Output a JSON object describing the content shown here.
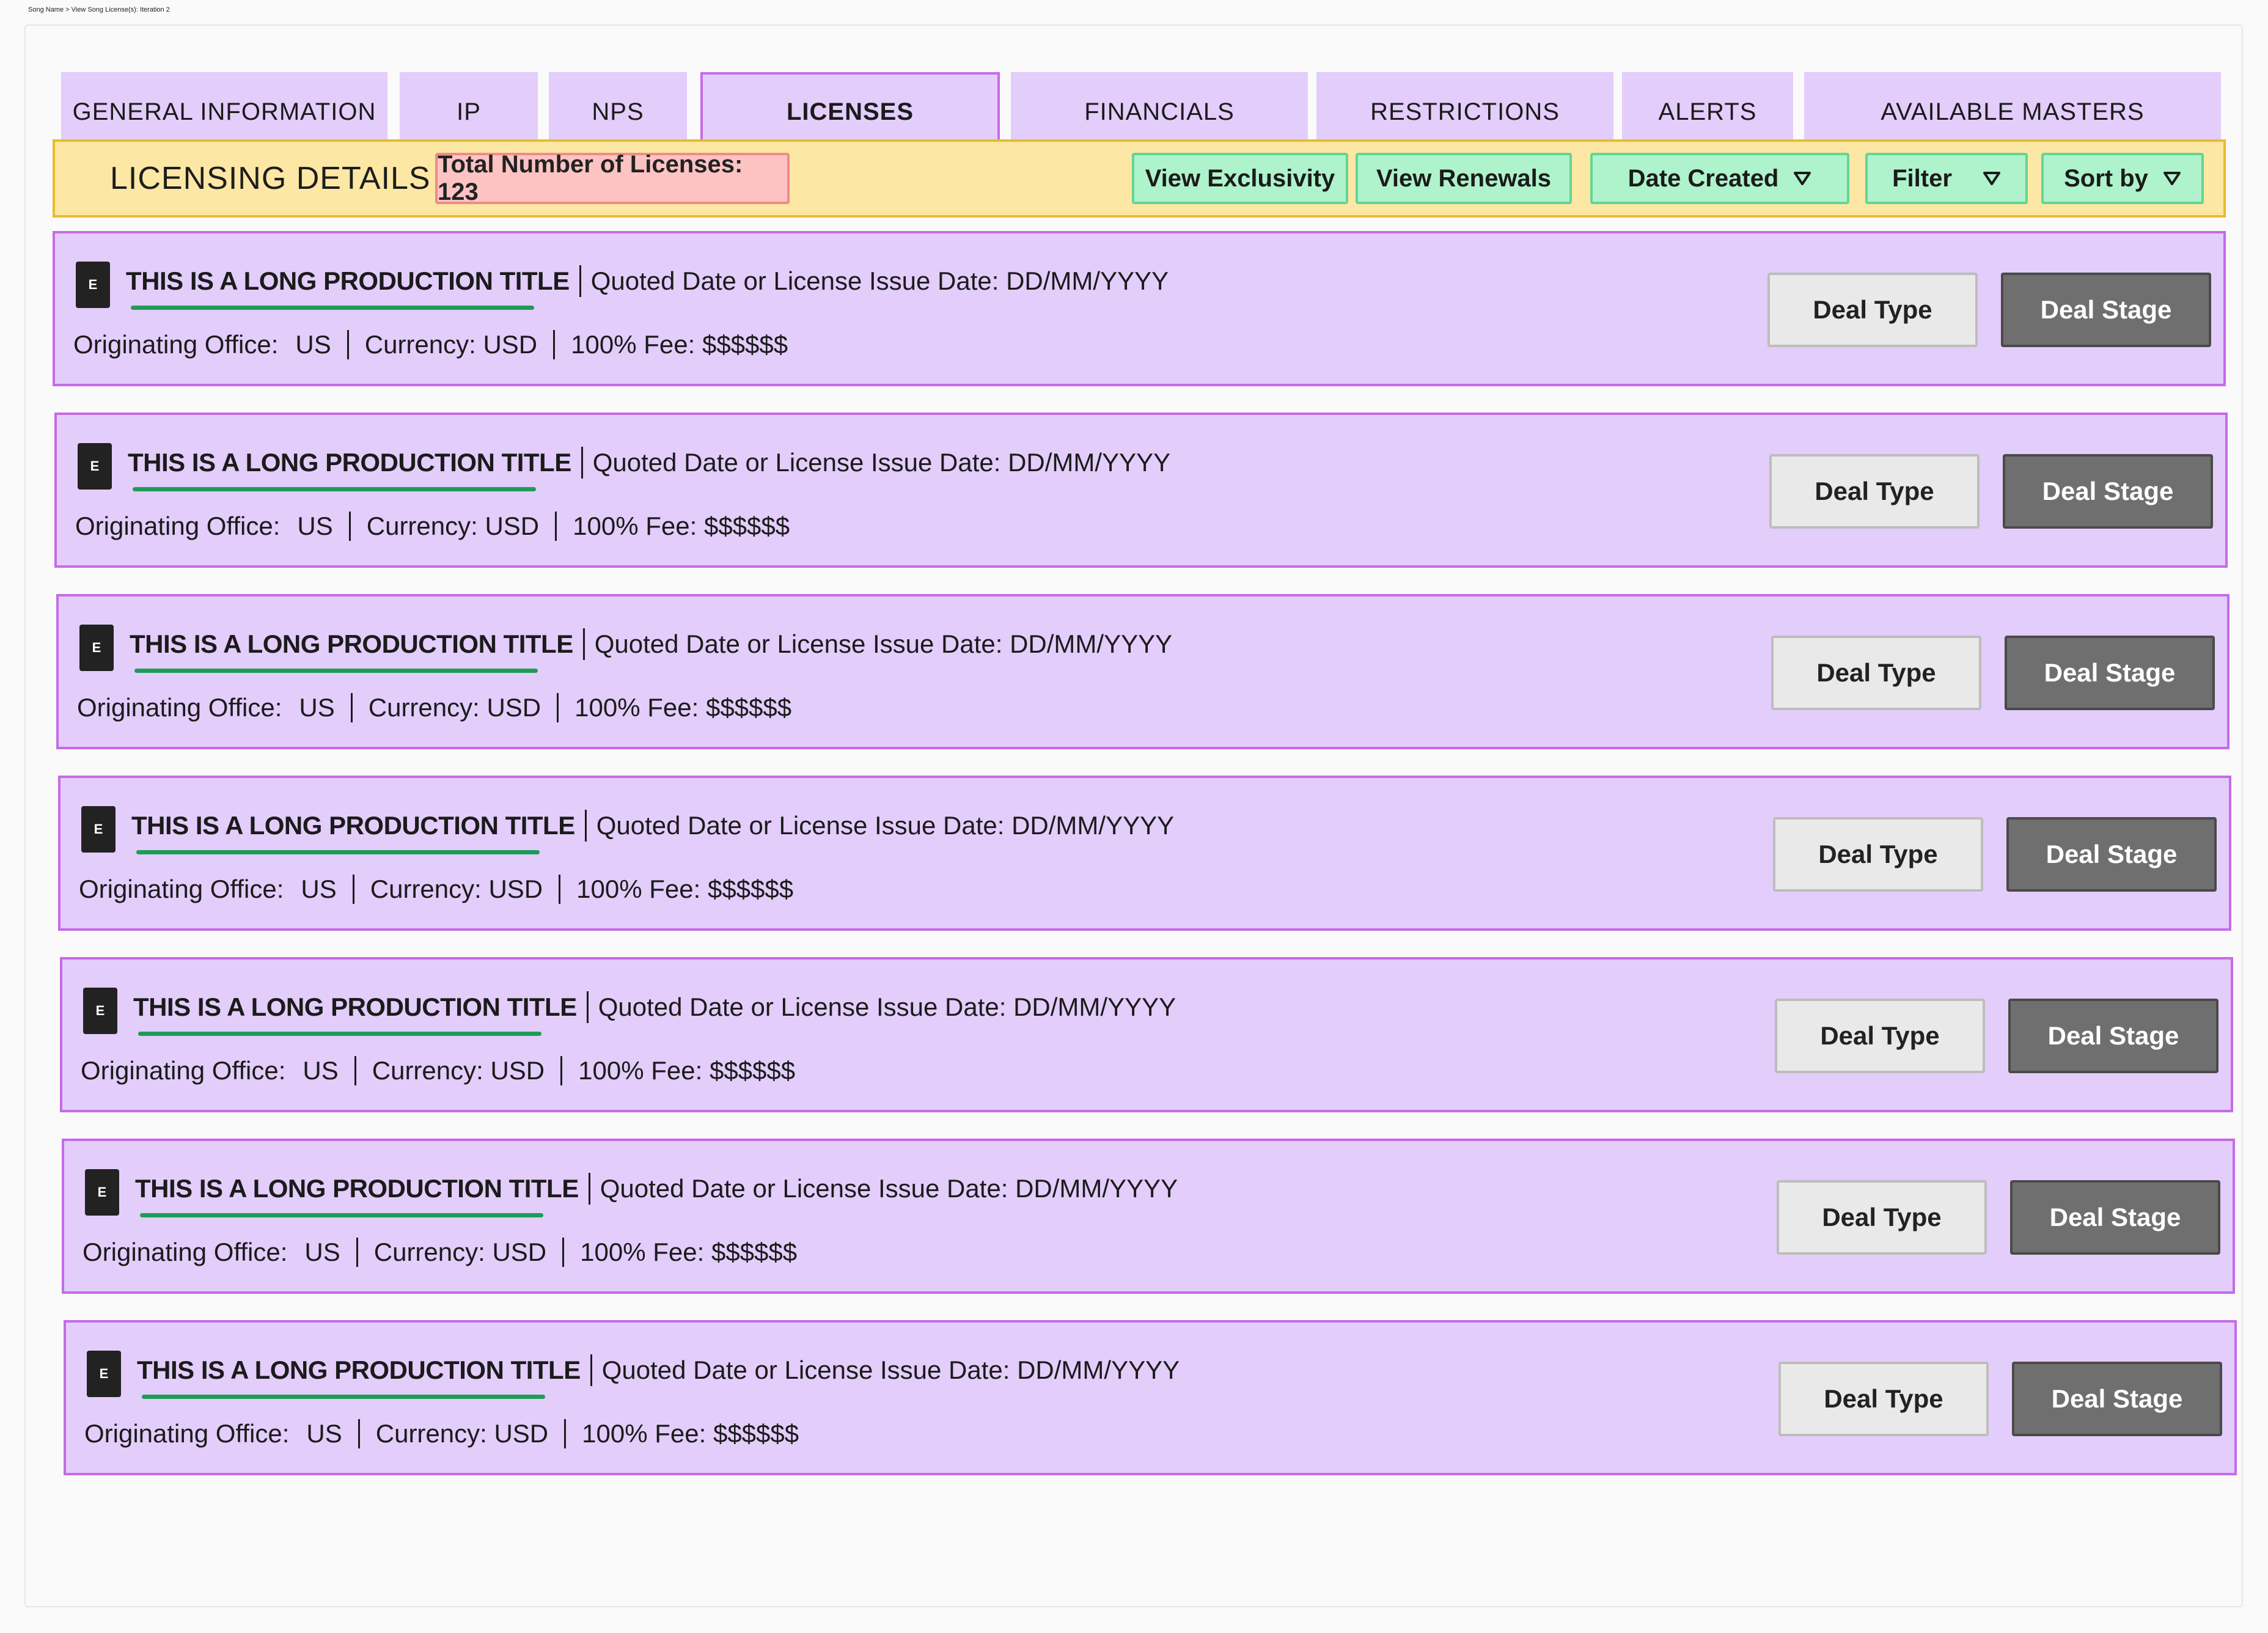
{
  "breadcrumb": "Song Name > View Song License(s): Iteration 2",
  "tabs": [
    {
      "label": "GENERAL INFORMATION"
    },
    {
      "label": "IP"
    },
    {
      "label": "NPS"
    },
    {
      "label": "LICENSES",
      "active": true
    },
    {
      "label": "FINANCIALS"
    },
    {
      "label": "RESTRICTIONS"
    },
    {
      "label": "ALERTS"
    },
    {
      "label": "AVAILABLE MASTERS"
    }
  ],
  "details": {
    "title": "LICENSING DETAILS",
    "count_label": "Total Number of Licenses: 123",
    "view_exclusivity": "View Exclusivity",
    "view_renewals": "View Renewals",
    "date_created": "Date Created",
    "filter": "Filter",
    "sort_by": "Sort by"
  },
  "licenses": [
    {
      "badge": "E",
      "title": "THIS IS A LONG PRODUCTION TITLE",
      "quoted": "Quoted Date or License Issue Date: DD/MM/YYYY",
      "office_label": "Originating Office:",
      "office": "US",
      "currency": "Currency: USD",
      "fee": "100% Fee: $$$$$$",
      "deal_type": "Deal Type",
      "deal_stage": "Deal Stage"
    },
    {
      "badge": "E",
      "title": "THIS IS A LONG PRODUCTION TITLE",
      "quoted": "Quoted Date or License Issue Date: DD/MM/YYYY",
      "office_label": "Originating Office:",
      "office": "US",
      "currency": "Currency: USD",
      "fee": "100% Fee: $$$$$$",
      "deal_type": "Deal Type",
      "deal_stage": "Deal Stage"
    },
    {
      "badge": "E",
      "title": "THIS IS A LONG PRODUCTION TITLE",
      "quoted": "Quoted Date or License Issue Date: DD/MM/YYYY",
      "office_label": "Originating Office:",
      "office": "US",
      "currency": "Currency: USD",
      "fee": "100% Fee: $$$$$$",
      "deal_type": "Deal Type",
      "deal_stage": "Deal Stage"
    },
    {
      "badge": "E",
      "title": "THIS IS A LONG PRODUCTION TITLE",
      "quoted": "Quoted Date or License Issue Date: DD/MM/YYYY",
      "office_label": "Originating Office:",
      "office": "US",
      "currency": "Currency: USD",
      "fee": "100% Fee: $$$$$$",
      "deal_type": "Deal Type",
      "deal_stage": "Deal Stage"
    },
    {
      "badge": "E",
      "title": "THIS IS A LONG PRODUCTION TITLE",
      "quoted": "Quoted Date or License Issue Date: DD/MM/YYYY",
      "office_label": "Originating Office:",
      "office": "US",
      "currency": "Currency: USD",
      "fee": "100% Fee: $$$$$$",
      "deal_type": "Deal Type",
      "deal_stage": "Deal Stage"
    },
    {
      "badge": "E",
      "title": "THIS IS A LONG PRODUCTION TITLE",
      "quoted": "Quoted Date or License Issue Date: DD/MM/YYYY",
      "office_label": "Originating Office:",
      "office": "US",
      "currency": "Currency: USD",
      "fee": "100% Fee: $$$$$$",
      "deal_type": "Deal Type",
      "deal_stage": "Deal Stage"
    },
    {
      "badge": "E",
      "title": "THIS IS A LONG PRODUCTION TITLE",
      "quoted": "Quoted Date or License Issue Date: DD/MM/YYYY",
      "office_label": "Originating Office:",
      "office": "US",
      "currency": "Currency: USD",
      "fee": "100% Fee: $$$$$$",
      "deal_type": "Deal Type",
      "deal_stage": "Deal Stage"
    }
  ],
  "colors": {
    "tab_bg": "#e3cdfb",
    "active_border": "#c76ae8",
    "details_bg": "#fde7a4",
    "count_bg": "#fdc3c3",
    "green_btn": "#aef3cb",
    "underline": "#1e9c57",
    "deal_stage_bg": "#6f6f6f"
  }
}
